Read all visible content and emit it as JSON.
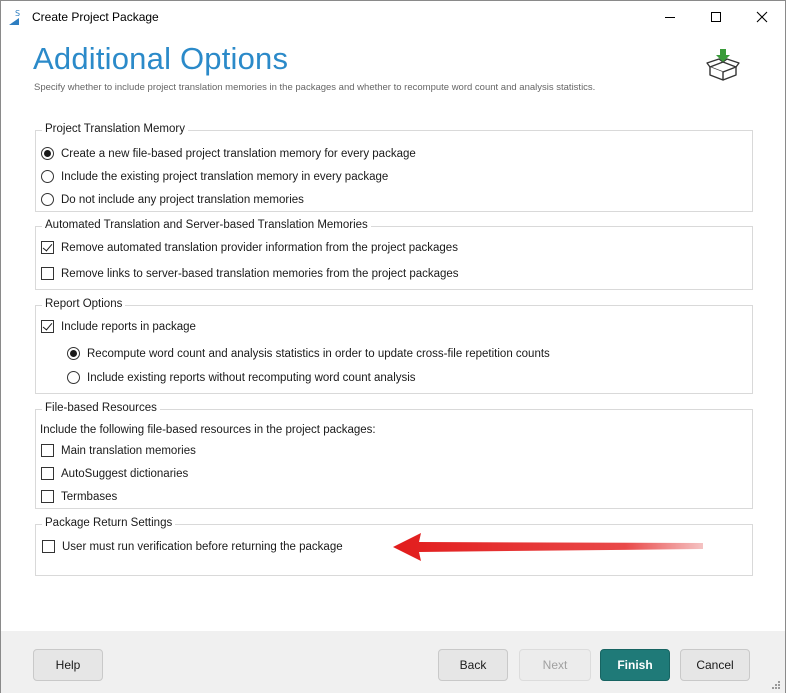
{
  "window": {
    "title": "Create Project Package"
  },
  "page": {
    "heading": "Additional Options",
    "subheading": "Specify whether to include project translation memories in the packages and whether to recompute word count and analysis statistics."
  },
  "groups": {
    "tm": {
      "legend": "Project Translation Memory",
      "options": [
        {
          "label": "Create a new file-based project translation memory for every package",
          "selected": true
        },
        {
          "label": "Include the existing project translation memory in every package",
          "selected": false
        },
        {
          "label": "Do not include any project translation memories",
          "selected": false
        }
      ]
    },
    "automated": {
      "legend": "Automated Translation and Server-based Translation Memories",
      "options": [
        {
          "label": "Remove automated translation provider information from the project packages",
          "checked": true
        },
        {
          "label": "Remove links to server-based translation memories from the project packages",
          "checked": false
        }
      ]
    },
    "reports": {
      "legend": "Report Options",
      "include_label": "Include reports in package",
      "include_checked": true,
      "options": [
        {
          "label": "Recompute word count and analysis statistics in order to update cross-file repetition counts",
          "selected": true
        },
        {
          "label": "Include existing reports without recomputing word count analysis",
          "selected": false
        }
      ]
    },
    "resources": {
      "legend": "File-based Resources",
      "intro": "Include the following file-based resources in the project packages:",
      "options": [
        {
          "label": "Main translation memories",
          "checked": false
        },
        {
          "label": "AutoSuggest dictionaries",
          "checked": false
        },
        {
          "label": "Termbases",
          "checked": false
        }
      ]
    },
    "return": {
      "legend": "Package Return Settings",
      "options": [
        {
          "label": "User must run verification before returning the package",
          "checked": false
        }
      ]
    }
  },
  "buttons": {
    "help": "Help",
    "back": "Back",
    "next": "Next",
    "finish": "Finish",
    "cancel": "Cancel"
  },
  "colors": {
    "heading": "#2b8ac9",
    "primary_button": "#1f7a78",
    "annotation_arrow": "#e01010"
  }
}
